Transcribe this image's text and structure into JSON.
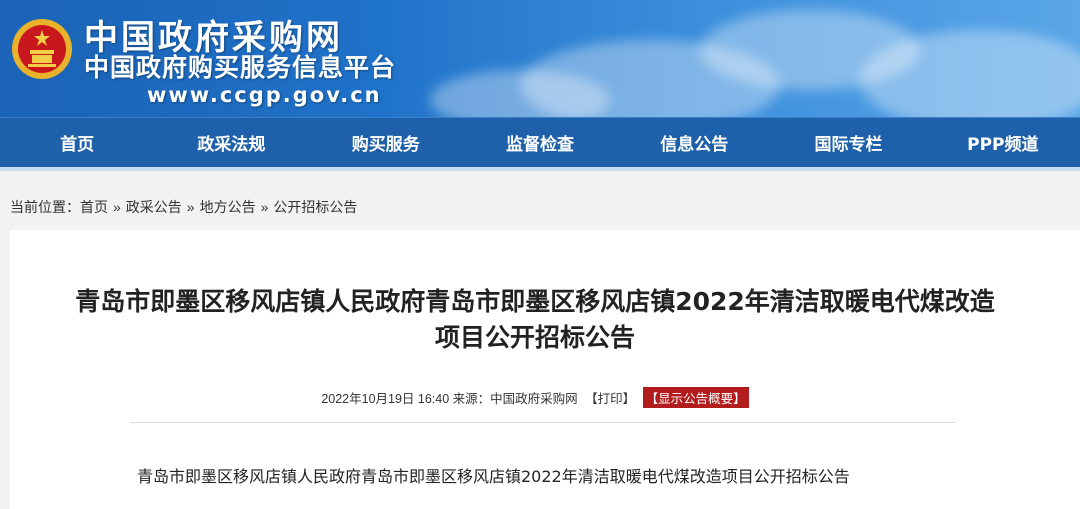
{
  "header": {
    "site_name": "中国政府采购网",
    "site_subname": "中国政府购买服务信息平台",
    "site_url": "www.ccgp.gov.cn"
  },
  "nav": {
    "items": [
      {
        "label": "首页"
      },
      {
        "label": "政采法规"
      },
      {
        "label": "购买服务"
      },
      {
        "label": "监督检查"
      },
      {
        "label": "信息公告"
      },
      {
        "label": "国际专栏"
      },
      {
        "label": "PPP频道"
      }
    ]
  },
  "breadcrumb": {
    "prefix": "当前位置：",
    "items": [
      "首页",
      "政采公告",
      "地方公告",
      "公开招标公告"
    ],
    "separator": "»"
  },
  "article": {
    "title_line1": "青岛市即墨区移风店镇人民政府青岛市即墨区移风店镇2022年清洁取暖电代煤改造",
    "title_line2": "项目公开招标公告",
    "datetime": "2022年10月19日 16:40",
    "source": "来源：中国政府采购网",
    "print_label": "【打印】",
    "summary_label": "【显示公告概要】",
    "body_first_line": "青岛市即墨区移风店镇人民政府青岛市即墨区移风店镇2022年清洁取暖电代煤改造项目公开招标公告"
  },
  "colors": {
    "header_blue": "#1f72c9",
    "nav_blue": "#1e60a9",
    "summary_red": "#b31c1c"
  }
}
